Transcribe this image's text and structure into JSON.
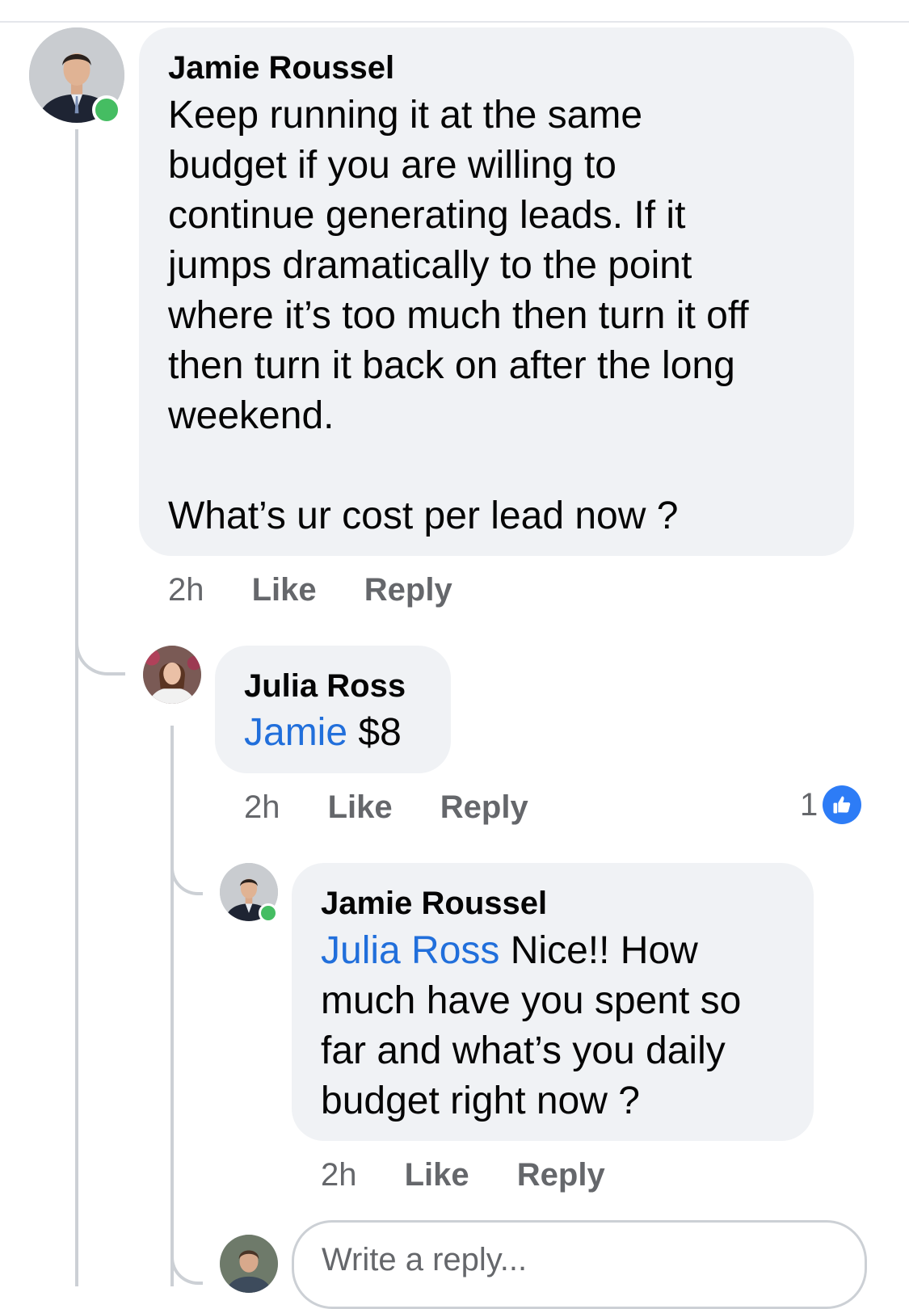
{
  "comments": [
    {
      "author": "Jamie Roussel",
      "text_lines": [
        "Keep running it at the same",
        "budget if you are willing to",
        "continue generating leads. If it",
        "jumps dramatically to the point",
        "where it’s too much then turn it off",
        "then turn it back on after the long",
        "weekend."
      ],
      "question": "What’s ur cost per lead now ?",
      "time": "2h",
      "like_label": "Like",
      "reply_label": "Reply"
    },
    {
      "author": "Julia Ross",
      "mention": "Jamie",
      "text": "$8",
      "time": "2h",
      "like_label": "Like",
      "reply_label": "Reply",
      "reaction_count": "1",
      "reaction_icon": "thumbs-up-icon",
      "reaction_color": "#2d7cf6"
    },
    {
      "author": "Jamie Roussel",
      "mention": "Julia Ross",
      "first_line_rest": "Nice!! How",
      "text_lines": [
        "much have you spent so",
        "far and what’s you daily",
        "budget right now ?"
      ],
      "time": "2h",
      "like_label": "Like",
      "reply_label": "Reply"
    }
  ],
  "reply_box": {
    "placeholder": "Write a reply..."
  },
  "colors": {
    "mention": "#216fdb",
    "online": "#45bd62",
    "bubble": "#f0f2f5"
  }
}
